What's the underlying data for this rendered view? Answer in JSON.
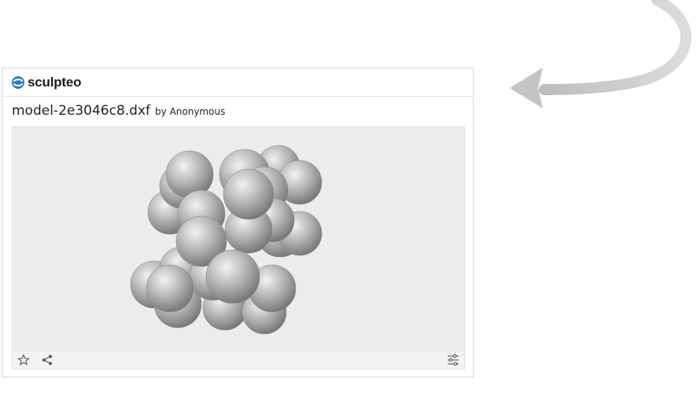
{
  "brand": {
    "name": "sculpteo",
    "color": "#2e7cc1"
  },
  "model": {
    "filename": "model-2e3046c8.dxf",
    "by_prefix": "by",
    "author": "Anonymous"
  },
  "toolbar": {
    "icons": [
      "star-icon",
      "share-icon",
      "settings-sliders-icon"
    ]
  },
  "decor": {
    "arrow_icon": "curved-arrow-icon",
    "arrow_color": "#c9c9c9"
  }
}
